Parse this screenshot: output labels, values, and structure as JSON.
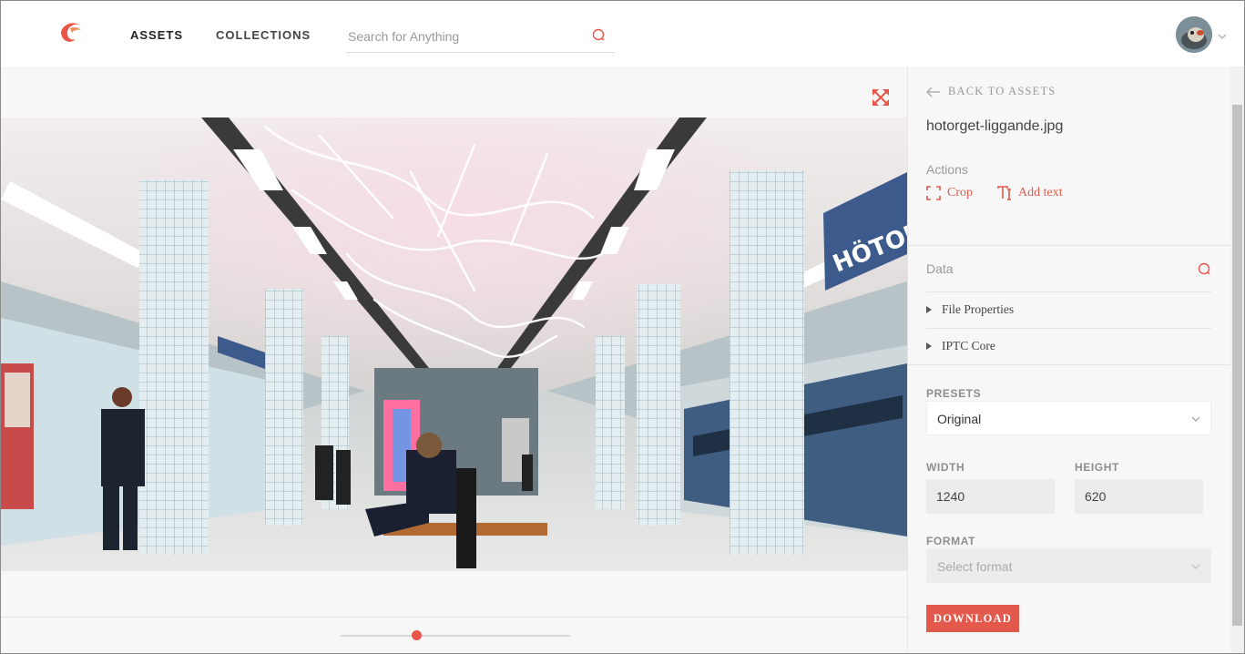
{
  "header": {
    "nav": [
      {
        "label": "ASSETS",
        "active": true
      },
      {
        "label": "COLLECTIONS",
        "active": false
      }
    ],
    "search": {
      "placeholder": "Search for Anything",
      "value": ""
    },
    "logo_icon": "bird-logo-icon",
    "accent_color": "#e8564a"
  },
  "viewer": {
    "expand_icon": "expand-arrows-icon",
    "image_alt": "hotorget-liggande.jpg",
    "sign_text": "HÖTORG",
    "zoom_level": 0.33
  },
  "panel": {
    "back_label": "BACK TO ASSETS",
    "file_name": "hotorget-liggande.jpg",
    "actions_label": "Actions",
    "actions": [
      {
        "label": "Crop",
        "icon": "crop-icon"
      },
      {
        "label": "Add text",
        "icon": "add-text-icon"
      }
    ],
    "data_label": "Data",
    "sections": [
      {
        "label": "File Properties"
      },
      {
        "label": "IPTC Core"
      }
    ],
    "presets": {
      "label": "PRESETS",
      "value": "Original"
    },
    "width": {
      "label": "WIDTH",
      "value": "1240"
    },
    "height": {
      "label": "HEIGHT",
      "value": "620"
    },
    "format": {
      "label": "FORMAT",
      "placeholder": "Select format"
    },
    "download_label": "DOWNLOAD"
  }
}
